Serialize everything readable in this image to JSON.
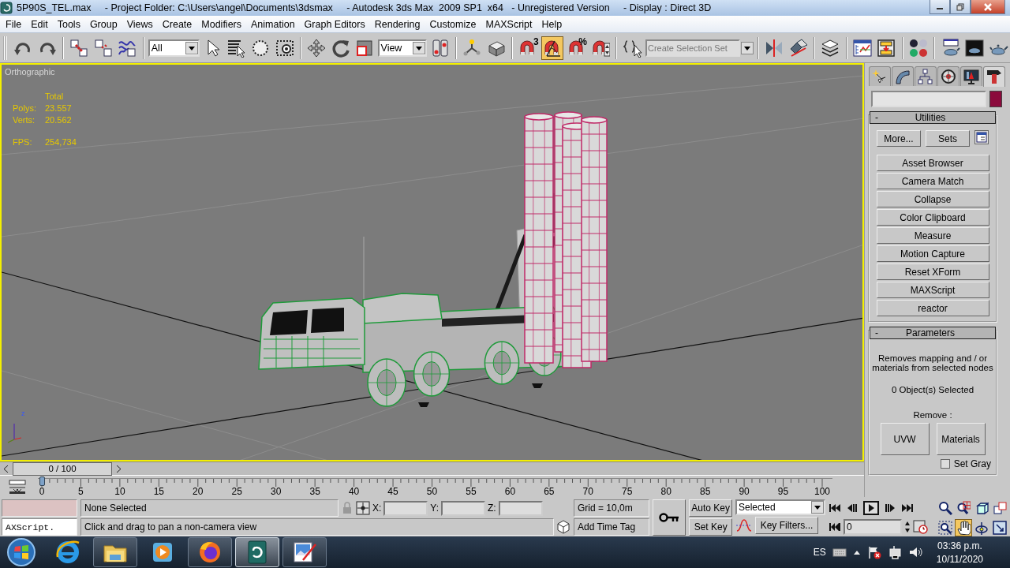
{
  "window": {
    "title": "5P90S_TEL.max     - Project Folder: C:\\Users\\angel\\Documents\\3dsmax     - Autodesk 3ds Max  2009 SP1  x64   - Unregistered Version     - Display : Direct 3D"
  },
  "menu": [
    "File",
    "Edit",
    "Tools",
    "Group",
    "Views",
    "Create",
    "Modifiers",
    "Animation",
    "Graph Editors",
    "Rendering",
    "Customize",
    "MAXScript",
    "Help"
  ],
  "toolbar": {
    "selection_filter": "All",
    "reference_coordinate": "View",
    "named_selection": {
      "placeholder": "Create Selection Set"
    },
    "snaps": [
      {
        "kind": "snap",
        "badge": "3",
        "selected": false
      },
      {
        "kind": "angle",
        "selected": true
      },
      {
        "kind": "percent",
        "badge": "%",
        "selected": false
      },
      {
        "kind": "spinner",
        "selected": false
      }
    ]
  },
  "viewport": {
    "label": "Orthographic",
    "active": true,
    "stats_header": "Total",
    "stats": [
      {
        "label": "Polys:",
        "value": "23.557"
      },
      {
        "label": "Verts:",
        "value": "20.562"
      },
      {
        "label": "FPS:",
        "value": "254,734"
      }
    ],
    "axis_label": "z"
  },
  "command_panel": {
    "tabs": [
      {
        "selected": false
      },
      {
        "selected": false
      },
      {
        "selected": false
      },
      {
        "selected": false
      },
      {
        "selected": false
      },
      {
        "selected": true
      }
    ],
    "utilities": {
      "collapse": "-",
      "title": "Utilities",
      "more": "More...",
      "sets": "Sets",
      "items": [
        "Asset Browser",
        "Camera Match",
        "Collapse",
        "Color Clipboard",
        "Measure",
        "Motion Capture",
        "Reset XForm",
        "MAXScript",
        "reactor"
      ]
    },
    "parameters": {
      "collapse": "-",
      "title": "Parameters",
      "description": "Removes mapping and / or materials from selected nodes",
      "count": "0 Object(s) Selected",
      "remove_label": "Remove :",
      "buttons": [
        "UVW",
        "Materials"
      ],
      "set_gray": {
        "label": "Set Gray",
        "checked": false
      }
    }
  },
  "time_slider": {
    "reading": "0 / 100",
    "level": 0
  },
  "track_bar": {
    "ticks": [
      "0",
      "5",
      "10",
      "15",
      "20",
      "25",
      "30",
      "35",
      "40",
      "45",
      "50",
      "55",
      "60",
      "65",
      "70",
      "75",
      "80",
      "85",
      "90",
      "95",
      "100"
    ]
  },
  "status": {
    "listener": "AXScript.",
    "selection": "None Selected",
    "coords": [
      "X:",
      "Y:",
      "Z:"
    ],
    "grid": "Grid = 10,0m",
    "prompt": "Click and drag to pan a non-camera view",
    "time_tag": "Add Time Tag",
    "auto_key": "Auto Key",
    "set_key": "Set Key",
    "key_mode": "Selected",
    "key_filters": "Key Filters...",
    "frame": "0",
    "nav": [
      {
        "selected": false
      },
      {
        "selected": false
      },
      {
        "selected": false
      },
      {
        "selected": false
      },
      {
        "selected": false
      },
      {
        "selected": true
      },
      {
        "selected": false
      },
      {
        "selected": false
      }
    ]
  },
  "taskbar": {
    "apps": [
      {
        "running": false,
        "selected": false
      },
      {
        "running": true,
        "selected": false
      },
      {
        "running": false,
        "selected": false
      },
      {
        "running": true,
        "selected": false
      },
      {
        "running": true,
        "selected": true
      },
      {
        "running": true,
        "selected": false
      }
    ],
    "language": "ES",
    "time": "03:36 p.m.",
    "date": "10/11/2020"
  }
}
